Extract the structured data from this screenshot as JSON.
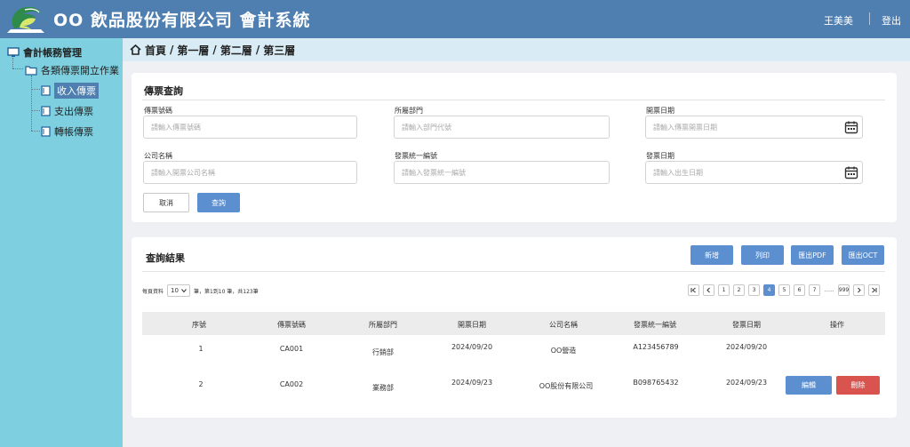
{
  "header": {
    "title": "OO 飲品股份有限公司  會計系統",
    "user": "王美美",
    "logout": "登出"
  },
  "sidebar": {
    "root": "會計帳務管理",
    "group": "各類傳票開立作業",
    "items": [
      "收入傳票",
      "支出傳票",
      "轉帳傳票"
    ]
  },
  "breadcrumb": [
    "首頁",
    "第一層",
    "第二層",
    "第三層"
  ],
  "search": {
    "title": "傳票查詢",
    "fields": [
      {
        "label": "傳票號碼",
        "placeholder": "請輸入傳票號碼"
      },
      {
        "label": "所屬部門",
        "placeholder": "請輸入部門代號"
      },
      {
        "label": "開票日期",
        "placeholder": "請輸入傳票開票日期"
      },
      {
        "label": "公司名稱",
        "placeholder": "請輸入開票公司名稱"
      },
      {
        "label": "發票統一編號",
        "placeholder": "請輸入發票統一編號"
      },
      {
        "label": "發票日期",
        "placeholder": "請輸入出生日期"
      }
    ],
    "cancel": "取消",
    "submit": "查詢"
  },
  "results": {
    "title": "查詢結果",
    "actions": [
      "新增",
      "列印",
      "匯出PDF",
      "匯出OCT"
    ],
    "per_page_label": "每頁資料",
    "per_page_value": "10",
    "range_text": "筆，第1到10 筆，共123筆",
    "pagination": {
      "pages": [
        "1",
        "2",
        "3",
        "4",
        "5",
        "6",
        "7"
      ],
      "current": "4",
      "ellipsis": "......",
      "last": "999"
    },
    "columns": [
      "序號",
      "傳票號碼",
      "所屬部門",
      "開票日期",
      "公司名稱",
      "發票統一編號",
      "發票日期",
      "操作"
    ],
    "rows": [
      {
        "no": "1",
        "voucher": "CA001",
        "dept": "行銷部",
        "open_date": "2024/09/20",
        "company": "OO營造",
        "tax_id": "A123456789",
        "invoice_date": "2024/09/20"
      },
      {
        "no": "2",
        "voucher": "CA002",
        "dept": "業務部",
        "open_date": "2024/09/23",
        "company": "OO股份有限公司",
        "tax_id": "B098765432",
        "invoice_date": "2024/09/23"
      }
    ],
    "edit": "編輯",
    "delete": "刪除"
  },
  "colors": {
    "header": "#4e7fb0",
    "sidebar": "#7ed0e0",
    "breadcrumb": "#d9ecf6",
    "primary": "#5b8fd0",
    "danger": "#d9534f"
  }
}
